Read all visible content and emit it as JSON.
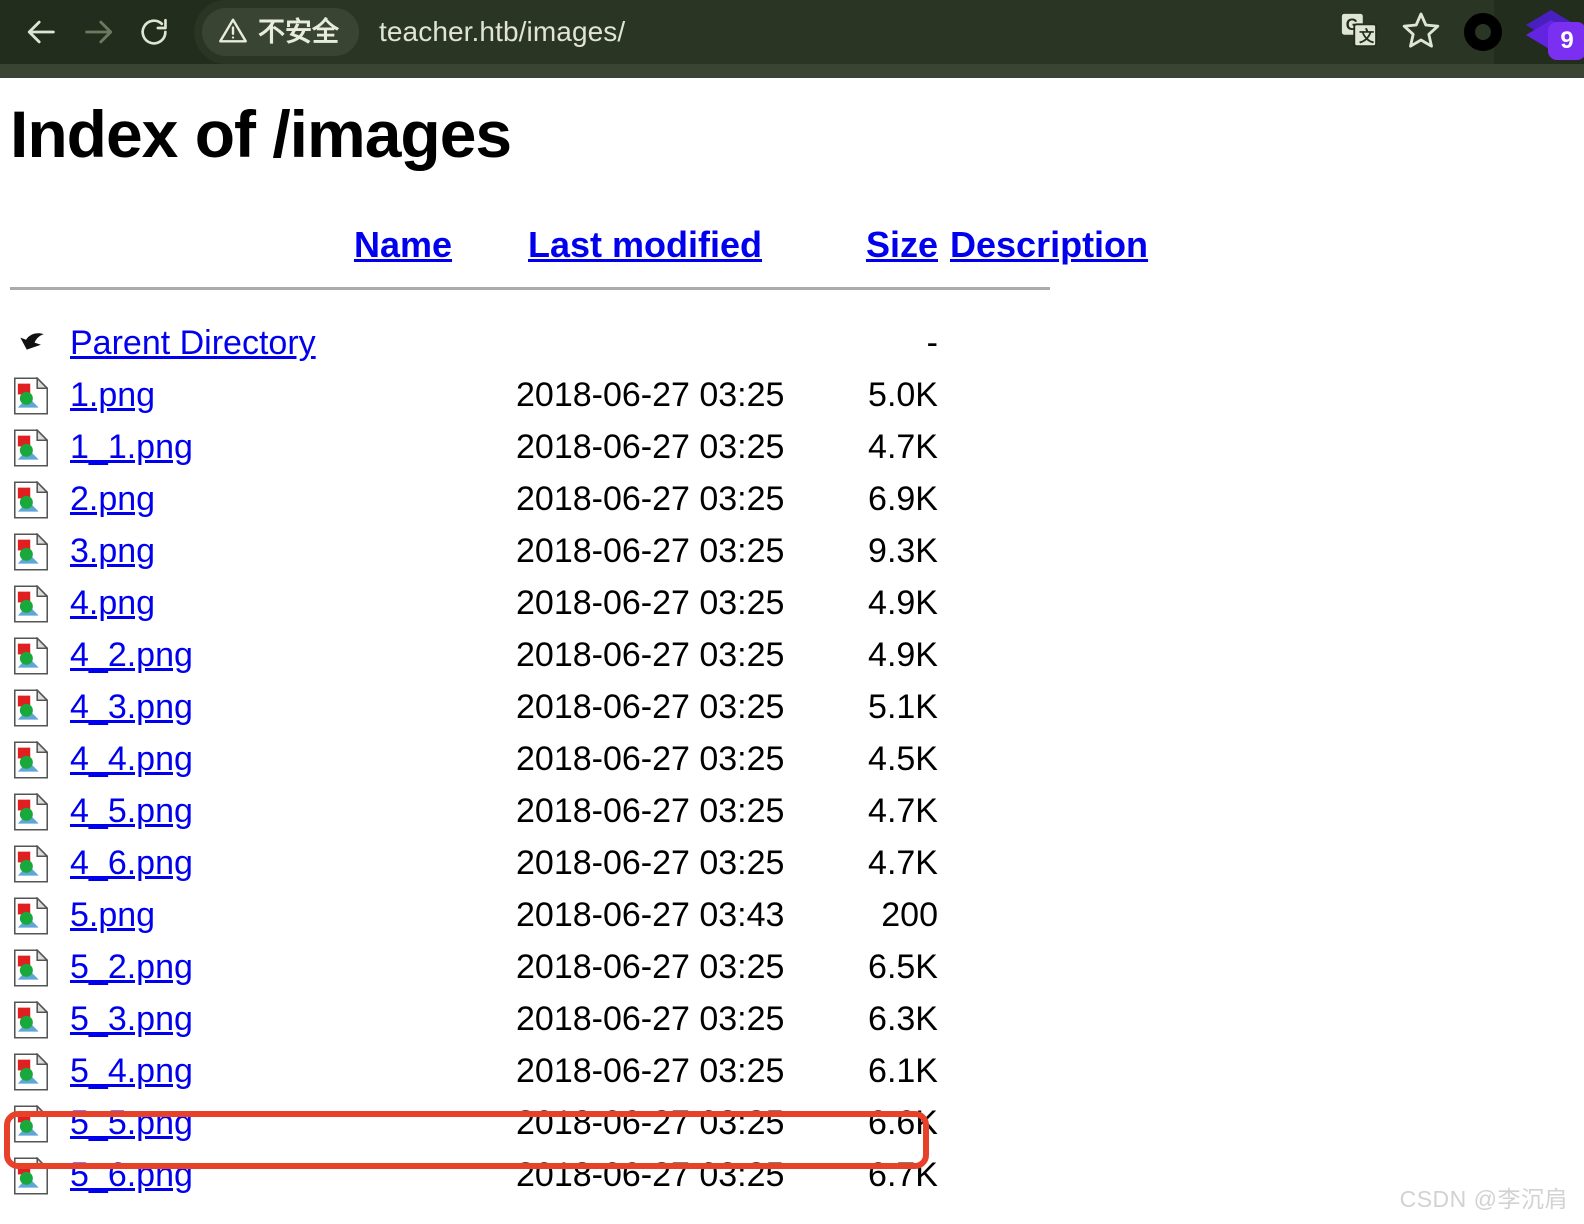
{
  "browser": {
    "back_label": "back-arrow",
    "forward_label": "forward-arrow",
    "reload_label": "reload",
    "security_text": "不安全",
    "url": "teacher.htb/images/",
    "translate_label": "translate",
    "bookmark_label": "bookmark-star",
    "extension_badge": "9"
  },
  "page": {
    "title": "Index of /images",
    "headers": {
      "name": "Name",
      "last_modified": "Last modified",
      "size": "Size",
      "description": "Description"
    },
    "parent": {
      "name": "Parent Directory",
      "date": "",
      "size": "-",
      "desc": ""
    },
    "rows": [
      {
        "name": "1.png",
        "date": "2018-06-27 03:25",
        "size": "5.0K",
        "desc": "",
        "highlight": false
      },
      {
        "name": "1_1.png",
        "date": "2018-06-27 03:25",
        "size": "4.7K",
        "desc": "",
        "highlight": false
      },
      {
        "name": "2.png",
        "date": "2018-06-27 03:25",
        "size": "6.9K",
        "desc": "",
        "highlight": false
      },
      {
        "name": "3.png",
        "date": "2018-06-27 03:25",
        "size": "9.3K",
        "desc": "",
        "highlight": false
      },
      {
        "name": "4.png",
        "date": "2018-06-27 03:25",
        "size": "4.9K",
        "desc": "",
        "highlight": false
      },
      {
        "name": "4_2.png",
        "date": "2018-06-27 03:25",
        "size": "4.9K",
        "desc": "",
        "highlight": false
      },
      {
        "name": "4_3.png",
        "date": "2018-06-27 03:25",
        "size": "5.1K",
        "desc": "",
        "highlight": false
      },
      {
        "name": "4_4.png",
        "date": "2018-06-27 03:25",
        "size": "4.5K",
        "desc": "",
        "highlight": false
      },
      {
        "name": "4_5.png",
        "date": "2018-06-27 03:25",
        "size": "4.7K",
        "desc": "",
        "highlight": false
      },
      {
        "name": "4_6.png",
        "date": "2018-06-27 03:25",
        "size": "4.7K",
        "desc": "",
        "highlight": false
      },
      {
        "name": "5.png",
        "date": "2018-06-27 03:43",
        "size": "200",
        "desc": "",
        "highlight": true
      },
      {
        "name": "5_2.png",
        "date": "2018-06-27 03:25",
        "size": "6.5K",
        "desc": "",
        "highlight": false
      },
      {
        "name": "5_3.png",
        "date": "2018-06-27 03:25",
        "size": "6.3K",
        "desc": "",
        "highlight": false
      },
      {
        "name": "5_4.png",
        "date": "2018-06-27 03:25",
        "size": "6.1K",
        "desc": "",
        "highlight": false
      },
      {
        "name": "5_5.png",
        "date": "2018-06-27 03:25",
        "size": "6.6K",
        "desc": "",
        "highlight": false
      },
      {
        "name": "5_6.png",
        "date": "2018-06-27 03:25",
        "size": "6.7K",
        "desc": "",
        "highlight": false
      }
    ]
  },
  "watermark": "CSDN @李沉肩",
  "colors": {
    "chrome_bg": "#232d1d",
    "chrome_strip": "#3b4433",
    "omnibox_bg": "#2b3524",
    "chip_bg": "#3a4433",
    "link": "#0000ee",
    "annotation": "#e8412a",
    "extension_purple": "#7b2ff0"
  }
}
